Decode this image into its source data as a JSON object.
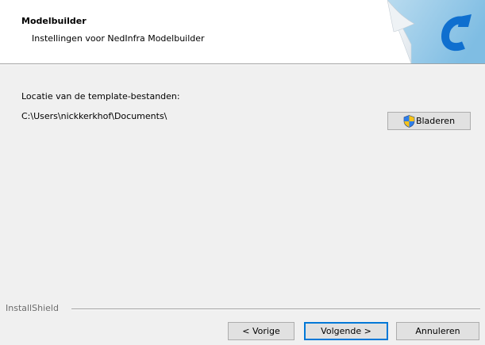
{
  "header": {
    "title": "Modelbuilder",
    "subtitle": "Instellingen voor NedInfra Modelbuilder",
    "logo_icon": "modelbuilder-c-logo-icon",
    "logo_color": "#1a7fd6"
  },
  "content": {
    "location_label": "Locatie van de template-bestanden:",
    "location_path": "C:\\Users\\nickkerkhof\\Documents\\",
    "browse_button": {
      "label": "Bladeren",
      "icon": "uac-shield-icon"
    }
  },
  "footer": {
    "brand": "InstallShield",
    "buttons": {
      "back": "< Vorige",
      "next": "Volgende >",
      "cancel": "Annuleren"
    }
  }
}
